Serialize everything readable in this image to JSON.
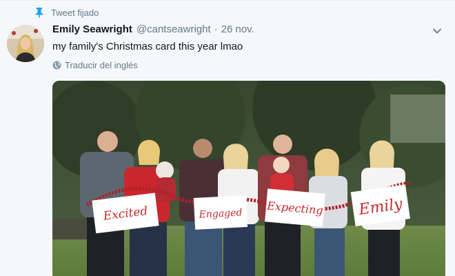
{
  "pinned": {
    "label": "Tweet fijado",
    "icon": "pin-icon"
  },
  "author": {
    "name": "Emily Seawright",
    "handle": "@cantseawright",
    "separator": "·",
    "date": "26 nov."
  },
  "tweet": {
    "text": "my family's Christmas card this year lmao",
    "translate_label": "Traducir del inglés"
  },
  "media": {
    "signs": [
      "Excited",
      "Engaged",
      "Expecting",
      "Emily"
    ]
  },
  "colors": {
    "accent": "#1da1f2",
    "muted": "#657786",
    "text": "#14171a",
    "sign_text": "#c8282d"
  }
}
